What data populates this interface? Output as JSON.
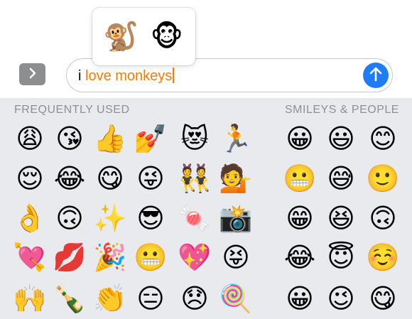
{
  "suggestions": {
    "items": [
      "🐒",
      "🐵"
    ]
  },
  "input": {
    "plain_text": "i ",
    "highlighted_text": "love monkeys"
  },
  "colors": {
    "highlight": "#ff7a00",
    "send": "#1f7cf5",
    "keyboard_bg": "#e9eaed",
    "header_text": "#8e8f94"
  },
  "icons": {
    "expand": "chevron-right-icon",
    "send": "arrow-up-icon"
  },
  "keyboard": {
    "frequently_used": {
      "header": "FREQUENTLY USED",
      "rows": [
        [
          "😩",
          "😘",
          "👍",
          "💅",
          "😻",
          "🏃"
        ],
        [
          "😌",
          "😂",
          "😋",
          "😜",
          "👯",
          "💁"
        ],
        [
          "👌",
          "🙃",
          "✨",
          "😎",
          "🍬",
          "📸"
        ],
        [
          "💘",
          "💋",
          "🎉",
          "😬",
          "💖",
          "😝"
        ],
        [
          "🙌",
          "🍾",
          "👏",
          "😑",
          "😞",
          "🍭"
        ]
      ]
    },
    "smileys_people": {
      "header": "SMILEYS & PEOPLE",
      "rows": [
        [
          "😀",
          "😃",
          "😊"
        ],
        [
          "😬",
          "😅",
          "🙂"
        ],
        [
          "😁",
          "😆",
          "🙃"
        ],
        [
          "😂",
          "😇",
          "☺️"
        ],
        [
          "😀",
          "😉",
          "😋"
        ]
      ]
    }
  }
}
